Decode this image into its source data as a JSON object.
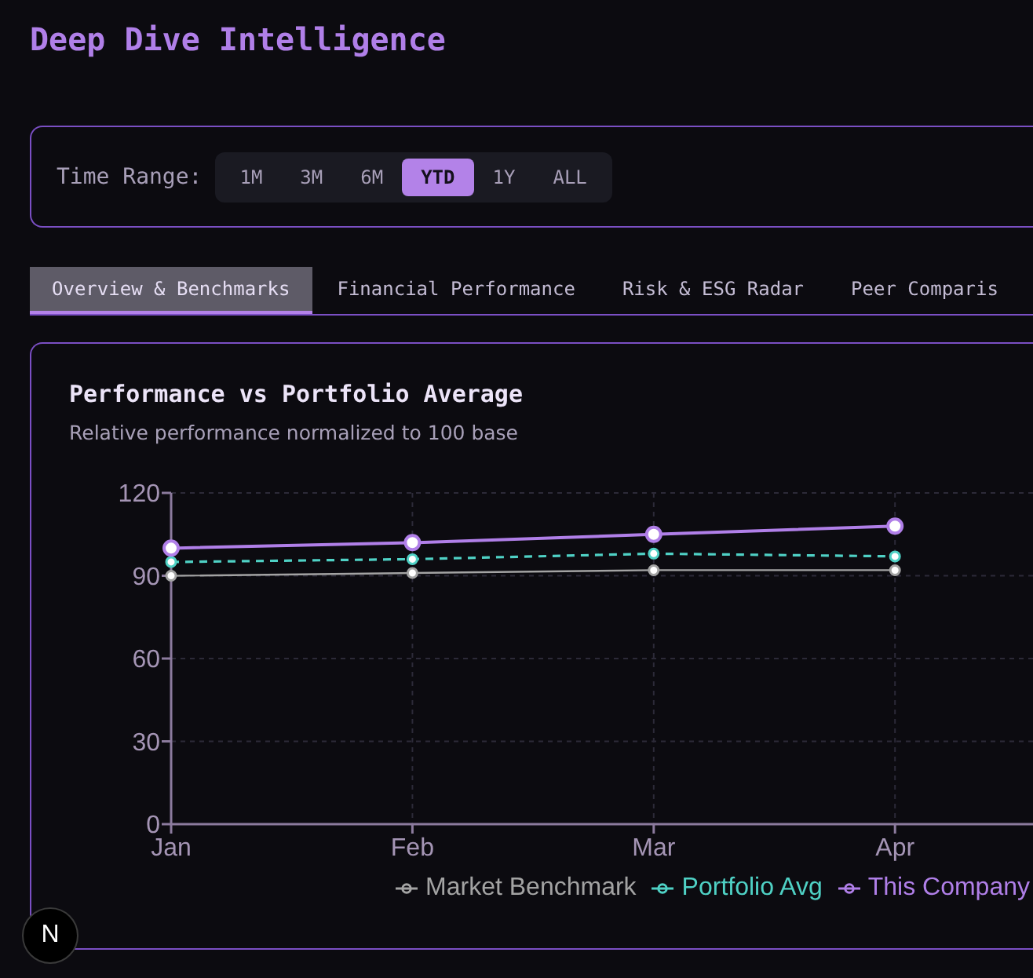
{
  "title": "Deep Dive Intelligence",
  "time_range": {
    "label": "Time Range:",
    "options": [
      {
        "label": "1M",
        "selected": false
      },
      {
        "label": "3M",
        "selected": false
      },
      {
        "label": "6M",
        "selected": false
      },
      {
        "label": "YTD",
        "selected": true
      },
      {
        "label": "1Y",
        "selected": false
      },
      {
        "label": "ALL",
        "selected": false
      }
    ]
  },
  "tabs": [
    {
      "label": "Overview & Benchmarks",
      "selected": true
    },
    {
      "label": "Financial Performance",
      "selected": false
    },
    {
      "label": "Risk & ESG Radar",
      "selected": false
    },
    {
      "label": "Peer Comparis",
      "selected": false
    }
  ],
  "performance_card": {
    "title": "Performance vs Portfolio Average",
    "subtitle": "Relative performance normalized to 100 base",
    "chart_data": {
      "type": "line",
      "categories": [
        "Jan",
        "Feb",
        "Mar",
        "Apr"
      ],
      "ylim": [
        0,
        120
      ],
      "yticks": [
        0,
        30,
        60,
        90,
        120
      ],
      "grid": true,
      "series": [
        {
          "name": "Market Benchmark",
          "color": "#a3a3a3",
          "values": [
            90,
            91,
            92,
            92
          ],
          "line_style": "solid",
          "marker": "circle"
        },
        {
          "name": "Portfolio Avg",
          "color": "#4fd1c5",
          "values": [
            95,
            96,
            98,
            97
          ],
          "line_style": "dashed",
          "marker": "circle"
        },
        {
          "name": "This Company",
          "color": "#b07fe8",
          "values": [
            100,
            102,
            105,
            108
          ],
          "line_style": "solid",
          "marker": "circle"
        }
      ]
    }
  },
  "dev_indicator": {
    "label": "N"
  }
}
